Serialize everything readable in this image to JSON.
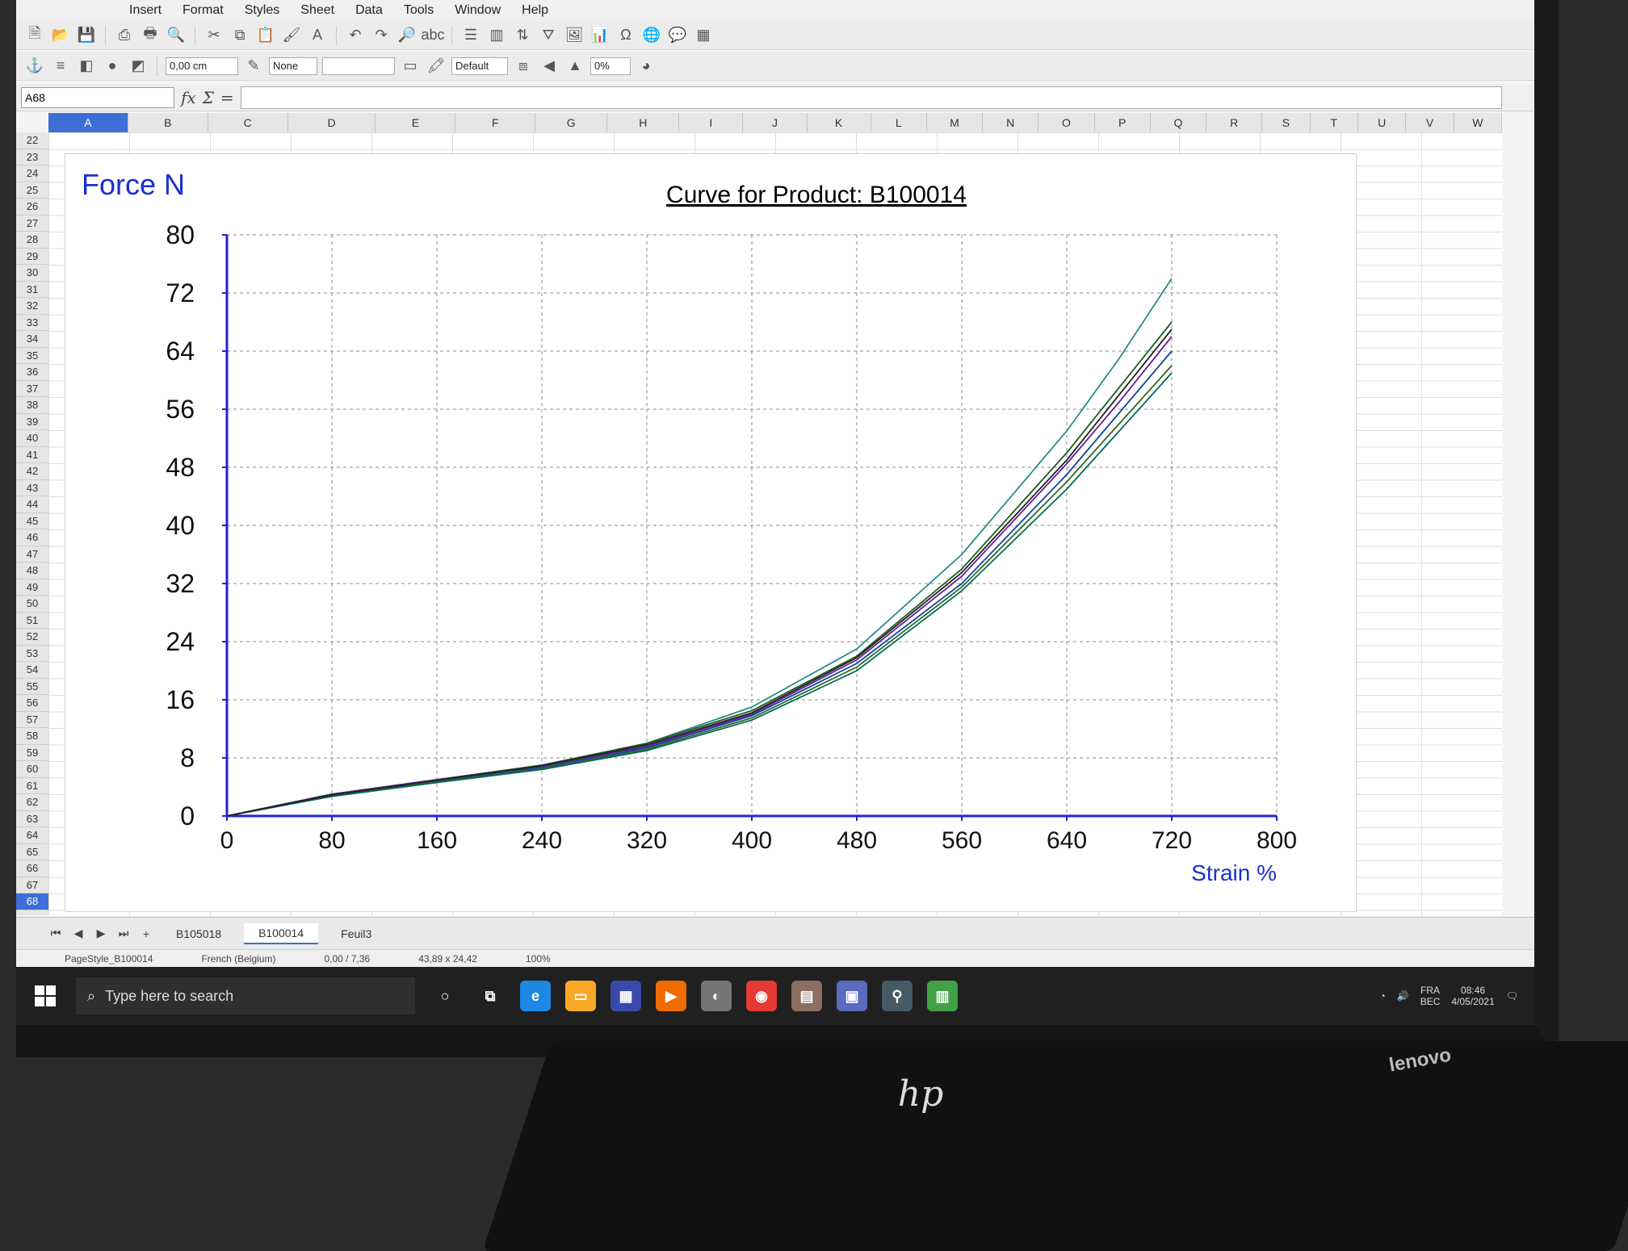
{
  "window": {
    "menu": [
      "Insert",
      "Format",
      "Styles",
      "Sheet",
      "Data",
      "Tools",
      "Window",
      "Help"
    ],
    "toolbar": {
      "indent_value": "0,00 cm",
      "border_style": "None",
      "style_name": "Default",
      "percent": "0%"
    },
    "name_box": "A68",
    "formula_value": ""
  },
  "columns": [
    "A",
    "B",
    "C",
    "D",
    "E",
    "F",
    "G",
    "H",
    "I",
    "J",
    "K",
    "L",
    "M",
    "N",
    "O",
    "P",
    "Q",
    "R",
    "S",
    "T",
    "U",
    "V",
    "W"
  ],
  "selected_column": "A",
  "rows": [
    "22",
    "23",
    "24",
    "25",
    "26",
    "27",
    "28",
    "29",
    "30",
    "31",
    "32",
    "33",
    "34",
    "35",
    "36",
    "37",
    "38",
    "39",
    "40",
    "41",
    "42",
    "43",
    "44",
    "45",
    "46",
    "47",
    "48",
    "49",
    "50",
    "51",
    "52",
    "53",
    "54",
    "55",
    "56",
    "57",
    "58",
    "59",
    "60",
    "61",
    "62",
    "63",
    "64",
    "65",
    "66",
    "67",
    "68"
  ],
  "selected_row": "68",
  "chart_data": {
    "type": "line",
    "title": "Curve for Product: B100014",
    "ylabel": "Force  N",
    "xlabel": "Strain  %",
    "xlim": [
      0,
      800
    ],
    "ylim": [
      0,
      80
    ],
    "x_ticks": [
      "0",
      "80",
      "160",
      "240",
      "320",
      "400",
      "480",
      "560",
      "640",
      "720",
      "800"
    ],
    "y_ticks": [
      "0",
      "8",
      "16",
      "24",
      "32",
      "40",
      "48",
      "56",
      "64",
      "72",
      "80"
    ],
    "grid": true,
    "x": [
      0,
      80,
      160,
      240,
      320,
      400,
      480,
      560,
      640,
      680,
      720
    ],
    "series": [
      {
        "color": "#2a8a8a",
        "values": [
          0,
          3,
          5,
          7,
          10,
          15,
          23,
          36,
          53,
          63,
          74
        ]
      },
      {
        "color": "#1b5e20",
        "values": [
          0,
          3,
          5,
          7,
          10,
          14.5,
          22,
          34,
          50,
          59,
          68
        ]
      },
      {
        "color": "#6a1b9a",
        "values": [
          0,
          3,
          5,
          6.8,
          9.6,
          14,
          21.5,
          33,
          48.5,
          57,
          66
        ]
      },
      {
        "color": "#0d47a1",
        "values": [
          0,
          2.8,
          4.8,
          6.6,
          9.4,
          13.8,
          21,
          32,
          47,
          55.5,
          64
        ]
      },
      {
        "color": "#33691e",
        "values": [
          0,
          2.8,
          4.7,
          6.5,
          9.2,
          13.5,
          20.5,
          31.5,
          46,
          54,
          62
        ]
      },
      {
        "color": "#00695c",
        "values": [
          0,
          2.7,
          4.6,
          6.4,
          9,
          13.2,
          20,
          31,
          45,
          53,
          61
        ]
      },
      {
        "color": "#222222",
        "values": [
          0,
          2.9,
          4.9,
          6.9,
          9.8,
          14.2,
          21.8,
          33.5,
          49,
          58,
          67
        ]
      }
    ]
  },
  "sheets": {
    "tabs": [
      "B105018",
      "B100014",
      "Feuil3"
    ],
    "active": "B100014",
    "add_label": "+"
  },
  "status": {
    "page_style": "PageStyle_B100014",
    "language": "French (Belgium)",
    "position": "0,00 / 7,36",
    "size": "43,89 x 24,42",
    "zoom": "100%"
  },
  "taskbar": {
    "search_placeholder": "Type here to search",
    "lang": "FRA",
    "lang2": "BEC",
    "time": "08:46",
    "date": "4/05/2021"
  },
  "monitor": {
    "brand": "hp",
    "keyboard_brand": "lenovo"
  }
}
